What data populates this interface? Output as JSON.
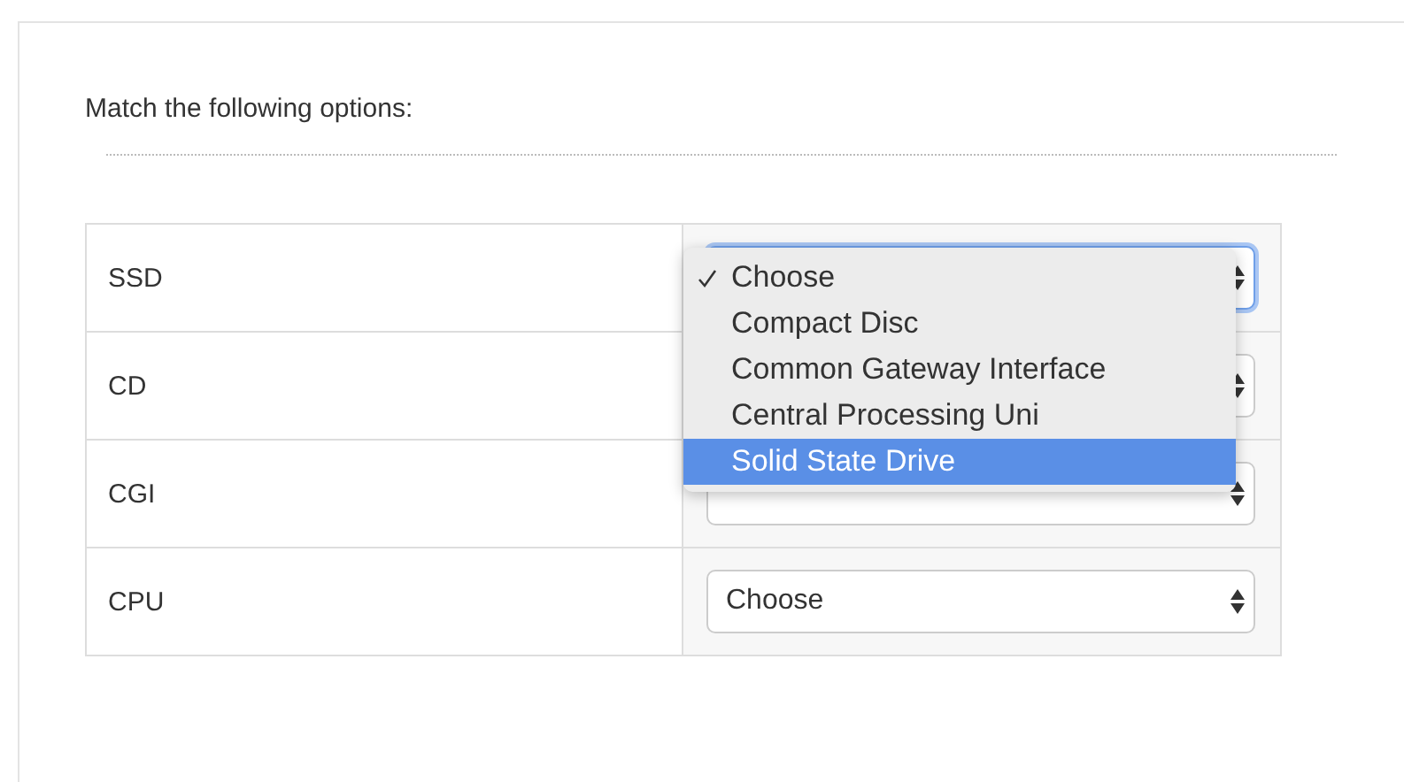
{
  "question": {
    "prompt": "Match the following options:"
  },
  "rows": [
    {
      "term": "SSD",
      "select": {
        "open": true,
        "focused": true,
        "options": [
          {
            "label": "Choose",
            "checked": true,
            "selected": false
          },
          {
            "label": "Compact Disc",
            "checked": false,
            "selected": false
          },
          {
            "label": "Common Gateway Interface",
            "checked": false,
            "selected": false
          },
          {
            "label": "Central Processing Uni",
            "checked": false,
            "selected": false
          },
          {
            "label": "Solid State Drive",
            "checked": false,
            "selected": true
          }
        ]
      }
    },
    {
      "term": "CD",
      "select": {
        "open": false,
        "focused": false
      }
    },
    {
      "term": "CGI",
      "select": {
        "open": false,
        "focused": false
      }
    },
    {
      "term": "CPU",
      "select": {
        "open": false,
        "focused": false,
        "value": "Choose"
      }
    }
  ]
}
